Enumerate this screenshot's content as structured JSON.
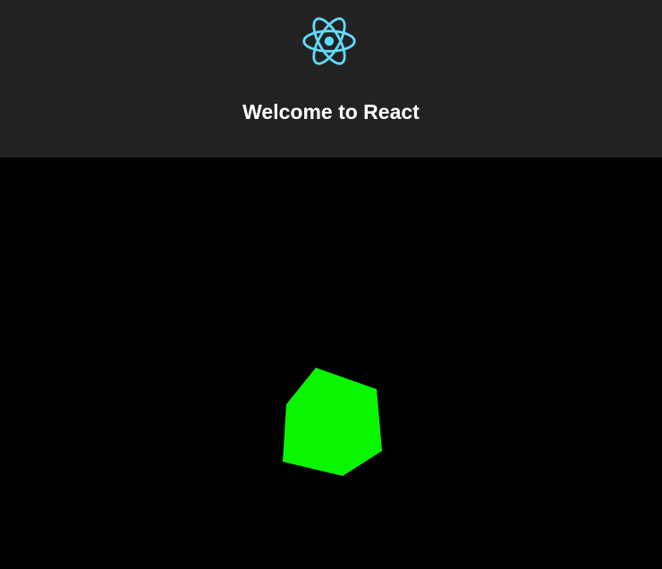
{
  "header": {
    "logo_icon": "react-atom-icon",
    "title": "Welcome to React"
  },
  "scene": {
    "object_icon": "rotating-cube",
    "colors": {
      "background": "#000000",
      "cube": "#0af500",
      "header_background": "#222222",
      "logo": "#61dafb",
      "title": "#ffffff"
    }
  }
}
